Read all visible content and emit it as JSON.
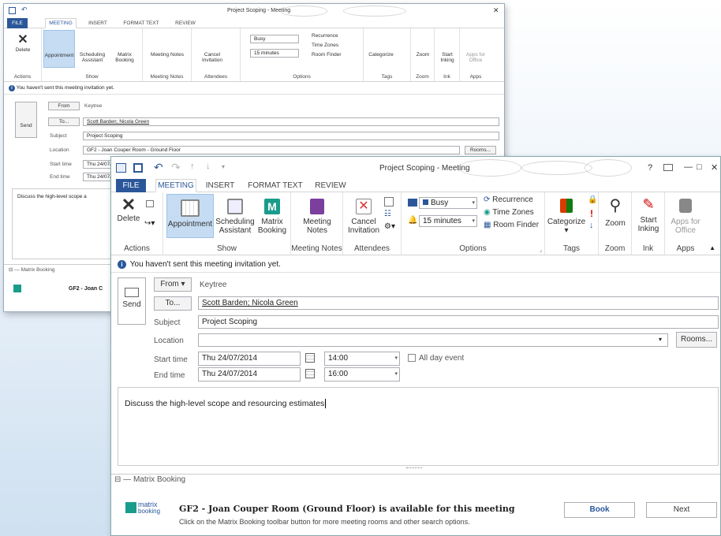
{
  "back": {
    "title": "Project Scoping - Meeting",
    "tabs": [
      "FILE",
      "MEETING",
      "INSERT",
      "FORMAT TEXT",
      "REVIEW"
    ],
    "ribbon": {
      "delete": "Delete",
      "appointment": "Appointment",
      "scheduling": "Scheduling Assistant",
      "matrix_booking": "Matrix Booking",
      "meeting_notes": "Meeting Notes",
      "cancel_invitation": "Cancel Invitation",
      "busy": "Busy",
      "reminder": "15 minutes",
      "recurrence": "Recurrence",
      "time_zones": "Time Zones",
      "room_finder": "Room Finder",
      "categorize": "Categorize",
      "zoom": "Zoom",
      "start_inking": "Start Inking",
      "apps_for_office": "Apps for Office",
      "groups": [
        "Actions",
        "Show",
        "Meeting Notes",
        "Attendees",
        "Options",
        "Tags",
        "Zoom",
        "Ink",
        "Apps"
      ]
    },
    "info": "You haven't sent this meeting invitation yet.",
    "send": "Send",
    "from_btn": "From",
    "from_value": "Keytree",
    "to_btn": "To...",
    "to_value": "Scott Barden; Nicola Green",
    "subject_label": "Subject",
    "subject_value": "Project Scoping",
    "location_label": "Location",
    "location_value": "GF2 - Joan Couper Room - Ground Floor",
    "rooms_btn": "Rooms...",
    "start_label": "Start time",
    "start_date": "Thu 24/07/",
    "end_label": "End time",
    "end_date": "Thu 24/07/",
    "body_text": "Discuss the high-level scope a",
    "mb_section": "Matrix Booking",
    "mb_text": "GF2 - Joan C"
  },
  "front": {
    "title": "Project Scoping - Meeting",
    "window_controls": [
      "?",
      "—",
      "□",
      "✕"
    ],
    "tabs": [
      "FILE",
      "MEETING",
      "INSERT",
      "FORMAT TEXT",
      "REVIEW"
    ],
    "ribbon": {
      "delete": "Delete",
      "appointment": "Appointment",
      "scheduling_1": "Scheduling",
      "scheduling_2": "Assistant",
      "matrix_1": "Matrix",
      "matrix_2": "Booking",
      "meeting_notes_1": "Meeting",
      "meeting_notes_2": "Notes",
      "cancel_1": "Cancel",
      "cancel_2": "Invitation",
      "busy": "Busy",
      "reminder": "15 minutes",
      "recurrence": "Recurrence",
      "time_zones": "Time Zones",
      "room_finder": "Room Finder",
      "categorize": "Categorize",
      "zoom": "Zoom",
      "start_inking_1": "Start",
      "start_inking_2": "Inking",
      "apps_1": "Apps for",
      "apps_2": "Office",
      "groups": [
        "Actions",
        "Show",
        "Meeting Notes",
        "Attendees",
        "Options",
        "Tags",
        "Zoom",
        "Ink",
        "Apps"
      ]
    },
    "info": "You haven't sent this meeting invitation yet.",
    "send": "Send",
    "from_btn": "From ▾",
    "from_value": "Keytree",
    "to_btn": "To...",
    "to_value": "Scott Barden; Nicola Green",
    "subject_label": "Subject",
    "subject_value": "Project Scoping",
    "location_label": "Location",
    "location_value": "",
    "rooms_btn": "Rooms...",
    "start_label": "Start time",
    "start_date": "Thu 24/07/2014",
    "start_time": "14:00",
    "all_day": "All day event",
    "end_label": "End time",
    "end_date": "Thu 24/07/2014",
    "end_time": "16:00",
    "body_text": "Discuss the high-level scope and resourcing estimates",
    "mb_section": "Matrix Booking",
    "mb_logo_1": "matrix",
    "mb_logo_2": "booking",
    "mb_headline": "GF2 - Joan Couper Room (Ground Floor) is available for this meeting",
    "mb_sub": "Click on the Matrix Booking toolbar button for more meeting rooms and other search options.",
    "book_btn": "Book",
    "next_btn": "Next"
  },
  "colors": {
    "accent": "#2b579a",
    "selected": "#c5dcf3",
    "matrix": "#1a9c8c"
  }
}
